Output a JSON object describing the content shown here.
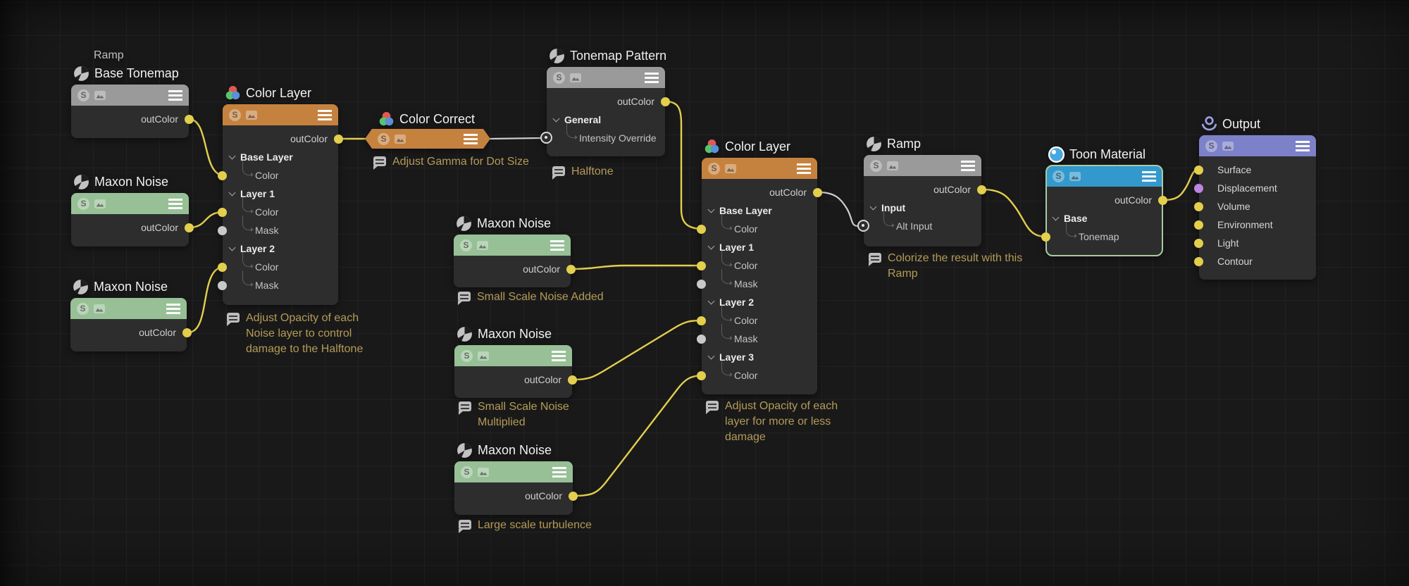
{
  "editor": {
    "background_color": "#19191a",
    "grid_color": "#222224",
    "wire_color": "#e3cf4c",
    "wire_alt_color": "#cfcfcf",
    "port_colors": {
      "yellow": "#e3cf4c",
      "gray": "#c9c9c9",
      "purple": "#bd84e0"
    },
    "header_colors": {
      "ramp": "#9a9a9a",
      "noise": "#97c096",
      "color_layer": "#c5823f",
      "toon": "#3399cc",
      "output": "#7c81c9"
    },
    "comment_color": "#b49b55",
    "selection_color": "#a9cba3"
  },
  "nodes": [
    {
      "context_label": "Ramp",
      "title": "Base Tonemap",
      "icon": "sphere-icon",
      "rows": [
        {
          "label": "outColor",
          "port": "yellow-out"
        }
      ]
    },
    {
      "title": "Maxon Noise",
      "icon": "sphere-icon",
      "rows": [
        {
          "label": "outColor",
          "port": "yellow-out"
        }
      ]
    },
    {
      "title": "Maxon Noise",
      "icon": "sphere-icon",
      "rows": [
        {
          "label": "outColor",
          "port": "yellow-out"
        }
      ]
    },
    {
      "title": "Color Layer",
      "icon": "rgb-icon",
      "rows": [
        {
          "label": "outColor",
          "port": "yellow-out"
        },
        {
          "label": "Base Layer",
          "port": "none"
        },
        {
          "label": "Color",
          "port": "yellow-in"
        },
        {
          "label": "Layer 1",
          "port": "none"
        },
        {
          "label": "Color",
          "port": "yellow-in"
        },
        {
          "label": "Mask",
          "port": "gray-in"
        },
        {
          "label": "Layer 2",
          "port": "none"
        },
        {
          "label": "Color",
          "port": "yellow-in"
        },
        {
          "label": "Mask",
          "port": "gray-in"
        }
      ]
    },
    {
      "title": "Color Correct",
      "icon": "rgb-icon",
      "collapsed": true
    },
    {
      "title": "Tonemap Pattern",
      "icon": "sphere-icon",
      "rows": [
        {
          "label": "outColor",
          "port": "yellow-out"
        },
        {
          "label": "General",
          "port": "none"
        },
        {
          "label": "Intensity Override",
          "port": "ring-in"
        }
      ]
    },
    {
      "title": "Maxon Noise",
      "icon": "sphere-icon",
      "rows": [
        {
          "label": "outColor",
          "port": "yellow-out"
        }
      ]
    },
    {
      "title": "Maxon Noise",
      "icon": "sphere-icon",
      "rows": [
        {
          "label": "outColor",
          "port": "yellow-out"
        }
      ]
    },
    {
      "title": "Maxon Noise",
      "icon": "sphere-icon",
      "rows": [
        {
          "label": "outColor",
          "port": "yellow-out"
        }
      ]
    },
    {
      "title": "Color Layer",
      "icon": "rgb-icon",
      "rows": [
        {
          "label": "outColor",
          "port": "yellow-out"
        },
        {
          "label": "Base Layer",
          "port": "none"
        },
        {
          "label": "Color",
          "port": "yellow-in"
        },
        {
          "label": "Layer 1",
          "port": "none"
        },
        {
          "label": "Color",
          "port": "yellow-in"
        },
        {
          "label": "Mask",
          "port": "gray-in"
        },
        {
          "label": "Layer 2",
          "port": "none"
        },
        {
          "label": "Color",
          "port": "yellow-in"
        },
        {
          "label": "Mask",
          "port": "gray-in"
        },
        {
          "label": "Layer 3",
          "port": "none"
        },
        {
          "label": "Color",
          "port": "yellow-in"
        }
      ]
    },
    {
      "title": "Ramp",
      "icon": "sphere-icon",
      "rows": [
        {
          "label": "outColor",
          "port": "yellow-out"
        },
        {
          "label": "Input",
          "port": "none"
        },
        {
          "label": "Alt Input",
          "port": "ring-in"
        }
      ]
    },
    {
      "title": "Toon Material",
      "icon": "toon-icon",
      "selected": true,
      "rows": [
        {
          "label": "outColor",
          "port": "yellow-out"
        },
        {
          "label": "Base",
          "port": "none"
        },
        {
          "label": "Tonemap",
          "port": "yellow-in"
        }
      ]
    },
    {
      "title": "Output",
      "icon": "output-icon",
      "rows": [
        {
          "label": "Surface",
          "port": "yellow-in"
        },
        {
          "label": "Displacement",
          "port": "purple-in"
        },
        {
          "label": "Volume",
          "port": "yellow-in"
        },
        {
          "label": "Environment",
          "port": "yellow-in"
        },
        {
          "label": "Light",
          "port": "yellow-in"
        },
        {
          "label": "Contour",
          "port": "yellow-in"
        }
      ]
    }
  ],
  "comments": [
    {
      "lines": [
        "Adjust Opacity of each",
        "Noise layer to control",
        "damage to the Halftone"
      ]
    },
    {
      "lines": [
        "Adjust Gamma for Dot Size"
      ]
    },
    {
      "lines": [
        "Halftone"
      ]
    },
    {
      "lines": [
        "Small Scale Noise Added"
      ]
    },
    {
      "lines": [
        "Small Scale Noise",
        "Multiplied"
      ]
    },
    {
      "lines": [
        "Large scale turbulence"
      ]
    },
    {
      "lines": [
        "Adjust Opacity of each",
        "layer for more or less",
        "damage"
      ]
    },
    {
      "lines": [
        "Colorize the result with this",
        "Ramp"
      ]
    }
  ],
  "header_badges": {
    "solo_label": "S"
  }
}
